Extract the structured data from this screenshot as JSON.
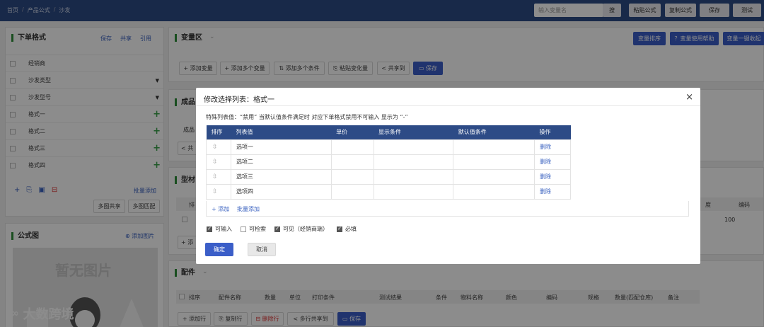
{
  "breadcrumb": {
    "home": "首页",
    "sep": "/",
    "products": "产品公式",
    "current": "沙发"
  },
  "topbar": {
    "var_placeholder": "输入变量名",
    "search": "搜",
    "paste": "粘贴公式",
    "copy": "复制公式",
    "save": "保存",
    "test": "测试"
  },
  "left": {
    "title": "下单格式",
    "save": "保存",
    "share": "共享",
    "quote": "引用",
    "items": [
      {
        "label": "经销商"
      },
      {
        "label": "沙发类型"
      },
      {
        "label": "沙发型号"
      },
      {
        "label": "格式一"
      },
      {
        "label": "格式二"
      },
      {
        "label": "格式三"
      },
      {
        "label": "格式四"
      }
    ],
    "batch_add": "批量添加",
    "multi_share": "多图共享",
    "multi_match": "多图匹配"
  },
  "formula": {
    "title": "公式图",
    "add_image": "⊕ 添加图片",
    "no_image": "暂无图片"
  },
  "varzone": {
    "title": "变量区",
    "sort_btn": "变量排序",
    "help_btn": "？变量使用帮助",
    "collapse_btn": "变量一键收起",
    "add_var": "+ 添加变量",
    "add_multi_var": "+ 添加多个变量",
    "add_multi_cond": "⇅ 添加多个条件",
    "paste_var": "⎘ 粘贴变化量",
    "share_to": "< 共享到",
    "save": "▭ 保存"
  },
  "finished": {
    "title_partial": "成品",
    "row_partial": "成品",
    "share_partial": "< 共"
  },
  "profile": {
    "title_partial": "型材",
    "col_partial": "排",
    "dim_partial": "度",
    "code": "编码",
    "value": "100",
    "add_partial": "+ 添"
  },
  "parts": {
    "title": "配件",
    "headers": [
      "排序",
      "配件名称",
      "数量",
      "单位",
      "打印条件",
      "测试结果",
      "条件",
      "物料名称",
      "颜色",
      "编码",
      "规格",
      "数量(匹配仓库)",
      "备注"
    ],
    "add_row": "+ 添加行",
    "copy_row": "⎘ 复制行",
    "del_row": "⊟ 删除行",
    "share_rows": "< 多行共享到",
    "save": "▭ 保存"
  },
  "watermark": "大数跨境",
  "modal": {
    "title": "修改选择列表：格式一",
    "close": "×",
    "note": "特殊列表值：“禁用” 当默认值条件满足时 对应下单格式禁用不可输入 显示为 “-”",
    "headers": {
      "sort": "排序",
      "value": "列表值",
      "price": "单价",
      "display": "显示条件",
      "default": "默认值条件",
      "op": "操作"
    },
    "rows": [
      {
        "value": "选项一",
        "op": "删除"
      },
      {
        "value": "选项二",
        "op": "删除"
      },
      {
        "value": "选项三",
        "op": "删除"
      },
      {
        "value": "选项四",
        "op": "删除"
      }
    ],
    "add": "+ 添加",
    "batch_add": "批量添加",
    "checks": [
      {
        "label": "可输入",
        "checked": true
      },
      {
        "label": "可检索",
        "checked": false
      },
      {
        "label": "可见（经销商端）",
        "checked": true
      },
      {
        "label": "必填",
        "checked": true
      }
    ],
    "confirm": "确定",
    "cancel": "取消"
  },
  "colors": {
    "nav": "#2d4b86",
    "accent": "#3b5ec8",
    "green": "#2f8f3a"
  }
}
